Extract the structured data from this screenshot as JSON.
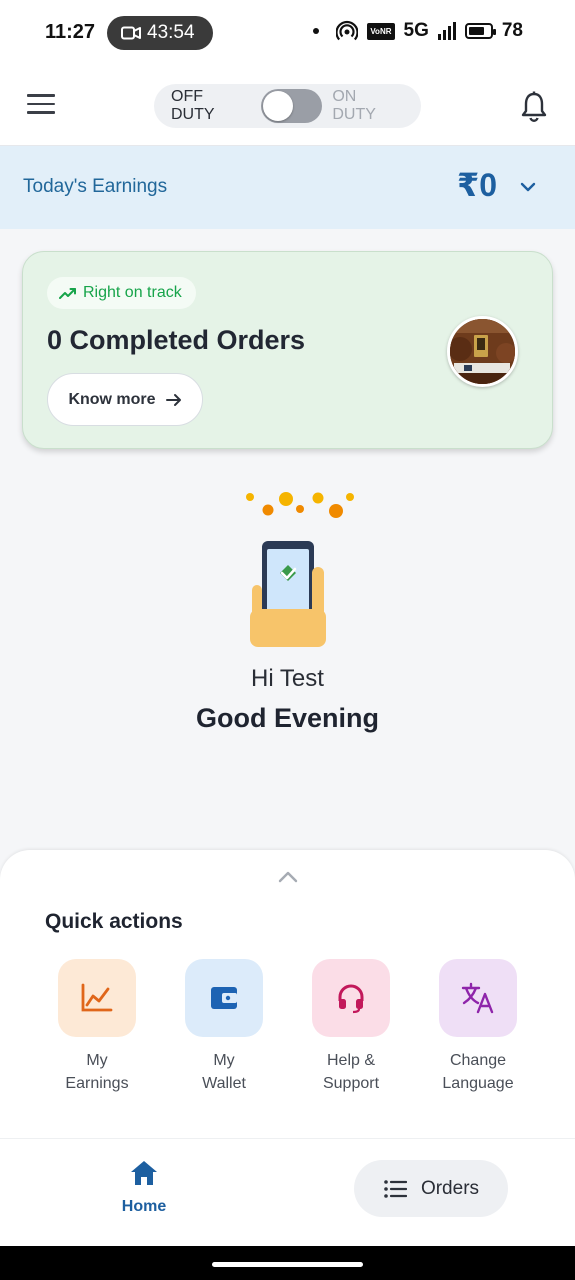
{
  "status_bar": {
    "time": "11:27",
    "recording_timer": "43:54",
    "network_badge": "VoNR",
    "network_type": "5G",
    "battery": "78",
    "battery_level": 0.78
  },
  "header": {
    "off_duty_label": "OFF DUTY",
    "on_duty_label": "ON DUTY",
    "on_duty": false
  },
  "earnings": {
    "label": "Today's Earnings",
    "amount": "₹0"
  },
  "track_card": {
    "badge": "Right on track",
    "title": "0 Completed Orders",
    "button_label": "Know more"
  },
  "greeting": {
    "hello": "Hi Test",
    "message": "Good Evening"
  },
  "quick_actions": {
    "title": "Quick actions",
    "items": [
      {
        "line1": "My",
        "line2": "Earnings",
        "icon": "earnings-chart-icon"
      },
      {
        "line1": "My",
        "line2": "Wallet",
        "icon": "wallet-icon"
      },
      {
        "line1": "Help &",
        "line2": "Support",
        "icon": "headset-icon"
      },
      {
        "line1": "Change",
        "line2": "Language",
        "icon": "translate-icon"
      }
    ]
  },
  "bottom_nav": {
    "home_label": "Home",
    "orders_label": "Orders"
  },
  "colors": {
    "accent": "#1d5fa0",
    "success": "#17a44a",
    "earnings_bg": "#e2eff9",
    "card_bg": "#e5f3e7"
  }
}
